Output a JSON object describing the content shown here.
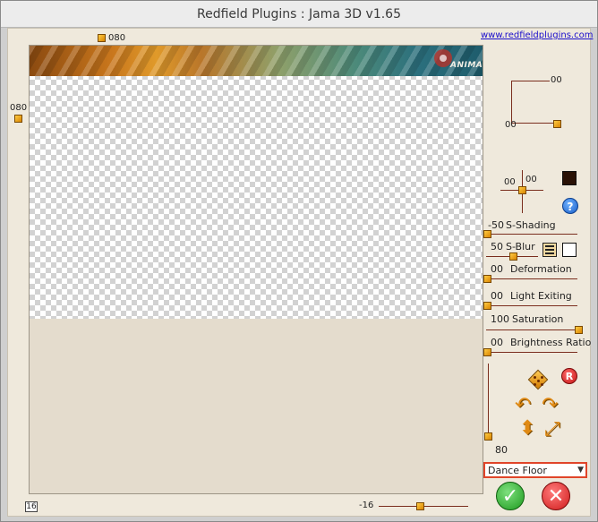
{
  "window": {
    "title": "Redfield Plugins : Jama 3D  v1.65"
  },
  "header": {
    "link": "www.redfieldplugins.com",
    "top_value": "080"
  },
  "preview": {
    "left_value": "080",
    "watermark": "ANIMABELLE"
  },
  "position_box": {
    "x_value": "00",
    "y_value": "00"
  },
  "light_pad": {
    "x_value": "00",
    "y_value": "00"
  },
  "sliders": [
    {
      "id": "s-shading",
      "value": "-50",
      "label": "S-Shading",
      "fraction": 0.0
    },
    {
      "id": "s-blur",
      "value": "50",
      "label": "S-Blur",
      "fraction": 0.5
    },
    {
      "id": "deformation",
      "value": "00",
      "label": "Deformation",
      "fraction": 0.0
    },
    {
      "id": "light-exiting",
      "value": "00",
      "label": "Light Exiting",
      "fraction": 0.0
    },
    {
      "id": "saturation",
      "value": "100",
      "label": "Saturation",
      "fraction": 1.0
    },
    {
      "id": "brightness-ratio",
      "value": "00",
      "label": "Brightness Ratio",
      "fraction": 0.0
    }
  ],
  "vertical_slider": {
    "value": "80",
    "fraction": 0.0
  },
  "preset": {
    "selected": "Dance Floor"
  },
  "bottom": {
    "corner_value": "16",
    "h_slider_value": "-16",
    "h_slider_fraction": 0.45
  },
  "buttons": {
    "help": "?",
    "reset": "R"
  },
  "colors": {
    "swatch_dark": "#2a1206",
    "swatch_light": "#ffffff",
    "accent": "#e0452a"
  },
  "icons": [
    "dice-icon",
    "rotate-left-icon",
    "rotate-right-icon",
    "flip-vertical-icon",
    "diagonal-arrow-icon",
    "ok-check-icon",
    "cancel-x-icon"
  ]
}
